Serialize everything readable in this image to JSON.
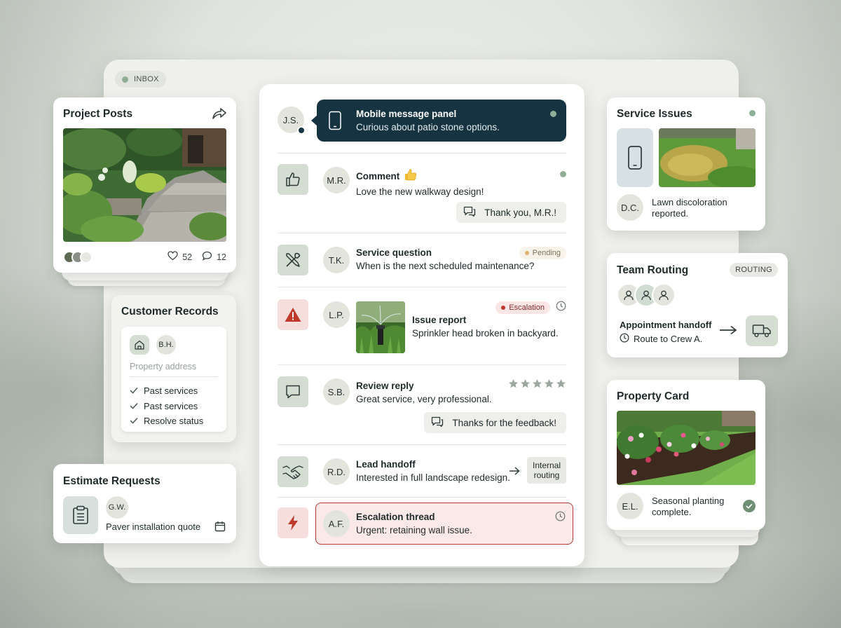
{
  "inbox": {
    "label": "INBOX"
  },
  "project_posts": {
    "title": "Project Posts",
    "likes": "52",
    "comments": "12"
  },
  "customer_records": {
    "title": "Customer Records",
    "initials": "B.H.",
    "placeholder": "Property address",
    "checks": [
      "Past services",
      "Past services",
      "Resolve status"
    ]
  },
  "estimate_requests": {
    "title": "Estimate Requests",
    "initials": "G.W.",
    "text": "Paver installation quote"
  },
  "feed": {
    "mobile": {
      "initials": "J.S.",
      "title": "Mobile message panel",
      "text": "Curious about patio stone options."
    },
    "comment": {
      "initials": "M.R.",
      "title": "Comment",
      "text": "Love the new walkway design!",
      "reply": "Thank you, M.R.!"
    },
    "service": {
      "initials": "T.K.",
      "title": "Service question",
      "text": "When is the next scheduled maintenance?",
      "badge": "Pending"
    },
    "issue": {
      "initials": "L.P.",
      "title": "Issue report",
      "text": "Sprinkler head broken in backyard.",
      "badge": "Escalation"
    },
    "review": {
      "initials": "S.B.",
      "title": "Review reply",
      "text": "Great service, very professional.",
      "reply": "Thanks for the feedback!",
      "stars": 5
    },
    "lead": {
      "initials": "R.D.",
      "title": "Lead handoff",
      "text": "Interested in full landscape redesign.",
      "routing_line1": "Internal",
      "routing_line2": "routing"
    },
    "escalation": {
      "initials": "A.F.",
      "title": "Escalation thread",
      "text": "Urgent: retaining wall issue."
    }
  },
  "service_issues": {
    "title": "Service Issues",
    "initials": "D.C.",
    "text_line1": "Lawn discoloration",
    "text_line2": "reported."
  },
  "team_routing": {
    "title": "Team Routing",
    "badge": "ROUTING",
    "handoff_title": "Appointment handoff",
    "handoff_text": "Route to Crew A."
  },
  "property_card": {
    "title": "Property Card",
    "initials": "E.L.",
    "text_line1": "Seasonal planting",
    "text_line2": "complete."
  },
  "colors": {
    "accent_green": "#8fae95",
    "dark_panel": "#153340",
    "alert_red": "#c0392b",
    "tile_green": "#d3ddd2"
  }
}
